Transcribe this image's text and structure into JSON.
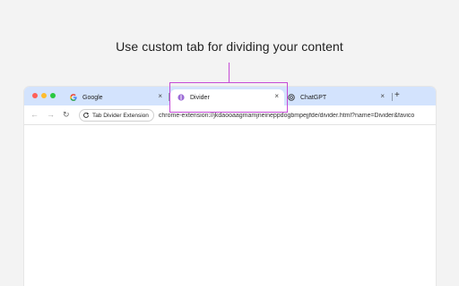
{
  "headline": "Use custom tab for dividing your content",
  "colors": {
    "accent": "#c54bd6",
    "tabstrip": "#d3e3fd",
    "background": "#f3f3f3"
  },
  "browser": {
    "tabs": [
      {
        "label": "Google",
        "icon": "google-icon",
        "active": false
      },
      {
        "label": "Divider",
        "icon": "divider-icon",
        "active": true
      },
      {
        "label": "ChatGPT",
        "icon": "chatgpt-icon",
        "active": false
      }
    ],
    "close_glyph": "×",
    "new_tab_glyph": "+",
    "nav": {
      "back": "←",
      "forward": "→",
      "reload": "↻"
    },
    "extension_chip": "Tab Divider Extension",
    "url": "chrome-extension://jkdaooaagmamjneineppdogbmpejjfde/divider.html?name=Divider&favico"
  }
}
